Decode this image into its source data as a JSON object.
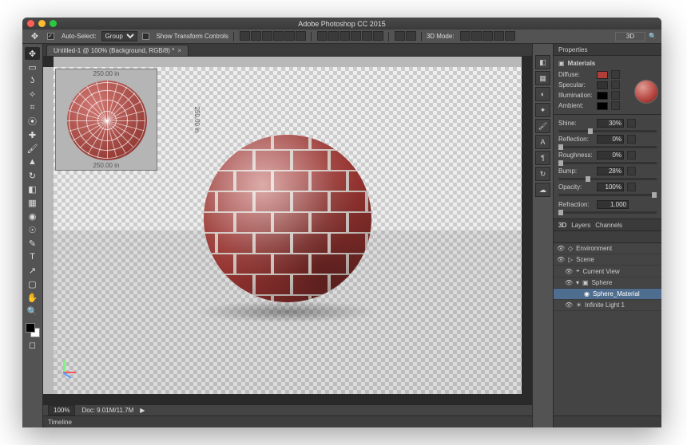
{
  "title": "Adobe Photoshop CC 2015",
  "options": {
    "auto_select_label": "Auto-Select:",
    "auto_select_value": "Group",
    "show_transform_label": "Show Transform Controls",
    "mode3d_label": "3D Mode:",
    "box3d": "3D"
  },
  "document": {
    "tab_title": "Untitled-1 @ 100% (Background, RGB/8) *"
  },
  "uv": {
    "dim": "250.00  in"
  },
  "status": {
    "zoom": "100%",
    "doc": "Doc: 9.01M/11.7M"
  },
  "timeline_label": "Timeline",
  "properties": {
    "panel": "Properties",
    "header": "Materials",
    "diffuse": "Diffuse:",
    "specular": "Specular:",
    "illumination": "Illumination:",
    "ambient": "Ambient:",
    "shine": {
      "label": "Shine:",
      "value": "30%"
    },
    "reflection": {
      "label": "Reflection:",
      "value": "0%"
    },
    "roughness": {
      "label": "Roughness:",
      "value": "0%"
    },
    "bump": {
      "label": "Bump:",
      "value": "28%"
    },
    "opacity": {
      "label": "Opacity:",
      "value": "100%"
    },
    "refraction": {
      "label": "Refraction:",
      "value": "1.000"
    }
  },
  "panel3d": {
    "tabs": {
      "d3": "3D",
      "layers": "Layers",
      "channels": "Channels"
    },
    "rows": {
      "env": "Environment",
      "scene": "Scene",
      "view": "Current View",
      "sphere": "Sphere",
      "material": "Sphere_Material",
      "light": "Infinite Light 1"
    }
  },
  "colors": {
    "brick": "#b23e3a"
  }
}
